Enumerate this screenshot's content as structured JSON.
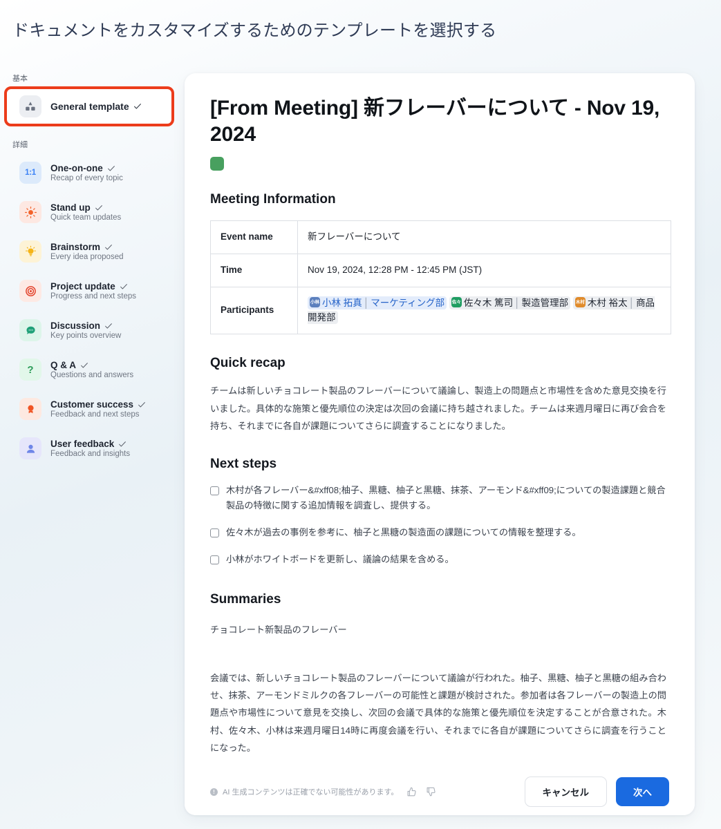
{
  "page": {
    "title": "ドキュメントをカスタマイズするためのテンプレートを選択する"
  },
  "colors": {
    "highlight_outline": "#ec3c1b",
    "primary_button": "#1a6ae0",
    "doc_color_chip": "#48a05f",
    "header_text": "#2f3b55"
  },
  "sidebar": {
    "sections": [
      {
        "label": "基本"
      },
      {
        "label": "詳細"
      }
    ],
    "basic_items": [
      {
        "name": "General template",
        "subtitle": "",
        "icon": "shapes-icon",
        "checked": true,
        "highlighted": true
      }
    ],
    "detail_items": [
      {
        "name": "One-on-one",
        "subtitle": "Recap of every topic",
        "icon": "one-on-one-icon",
        "checked": true
      },
      {
        "name": "Stand up",
        "subtitle": "Quick team updates",
        "icon": "sun-icon",
        "checked": true
      },
      {
        "name": "Brainstorm",
        "subtitle": "Every idea proposed",
        "icon": "lightbulb-icon",
        "checked": true
      },
      {
        "name": "Project update",
        "subtitle": "Progress and next steps",
        "icon": "target-icon",
        "checked": true
      },
      {
        "name": "Discussion",
        "subtitle": "Key points overview",
        "icon": "chat-bubble-icon",
        "checked": true
      },
      {
        "name": "Q & A",
        "subtitle": "Questions and answers",
        "icon": "question-mark-icon",
        "checked": true
      },
      {
        "name": "Customer success",
        "subtitle": "Feedback and next steps",
        "icon": "award-icon",
        "checked": true
      },
      {
        "name": "User feedback",
        "subtitle": "Feedback and insights",
        "icon": "person-icon",
        "checked": true
      }
    ]
  },
  "document": {
    "title": "[From Meeting] 新フレーバーについて - Nov 19, 2024",
    "meeting_information": {
      "heading": "Meeting Information",
      "rows": [
        {
          "key": "Event name",
          "value": "新フレーバーについて"
        },
        {
          "key": "Time",
          "value": "Nov 19, 2024, 12:28 PM - 12:45 PM (JST)"
        }
      ],
      "participants_key": "Participants",
      "participants": [
        {
          "initials": "小林",
          "name": "小林 拓真",
          "department": "マーケティング部",
          "style": "blue"
        },
        {
          "initials": "佐々",
          "name": "佐々木 篤司",
          "department": "製造管理部",
          "style": "grey"
        },
        {
          "initials": "木村",
          "name": "木村 裕太",
          "department": "商品開発部",
          "style": "grey"
        }
      ]
    },
    "quick_recap": {
      "heading": "Quick recap",
      "text": "チームは新しいチョコレート製品のフレーバーについて議論し、製造上の問題点と市場性を含めた意見交換を行いました。具体的な施策と優先順位の決定は次回の会議に持ち越されました。チームは来週月曜日に再び会合を持ち、それまでに各自が課題についてさらに調査することになりました。"
    },
    "next_steps": {
      "heading": "Next steps",
      "items": [
        "木村が各フレーバー&#xff08;柚子、黒糖、柚子と黒糖、抹茶、アーモンド&#xff09;についての製造課題と競合製品の特徴に関する追加情報を調査し、提供する。",
        "佐々木が過去の事例を参考に、柚子と黒糖の製造面の課題についての情報を整理する。",
        "小林がホワイトボードを更新し、議論の結果を含める。"
      ]
    },
    "summaries": {
      "heading": "Summaries",
      "lead": "チョコレート新製品のフレーバー",
      "text": "会議では、新しいチョコレート製品のフレーバーについて議論が行われた。柚子、黒糖、柚子と黒糖の組み合わせ、抹茶、アーモンドミルクの各フレーバーの可能性と課題が検討された。参加者は各フレーバーの製造上の問題点や市場性について意見を交換し、次回の会議で具体的な施策と優先順位を決定することが合意された。木村、佐々木、小林は来週月曜日14時に再度会議を行い、それまでに各自が課題についてさらに調査を行うことになった。"
    },
    "footer": {
      "ai_notice": "AI 生成コンテンツは正確でない可能性があります。",
      "cancel_label": "キャンセル",
      "next_label": "次へ"
    }
  }
}
